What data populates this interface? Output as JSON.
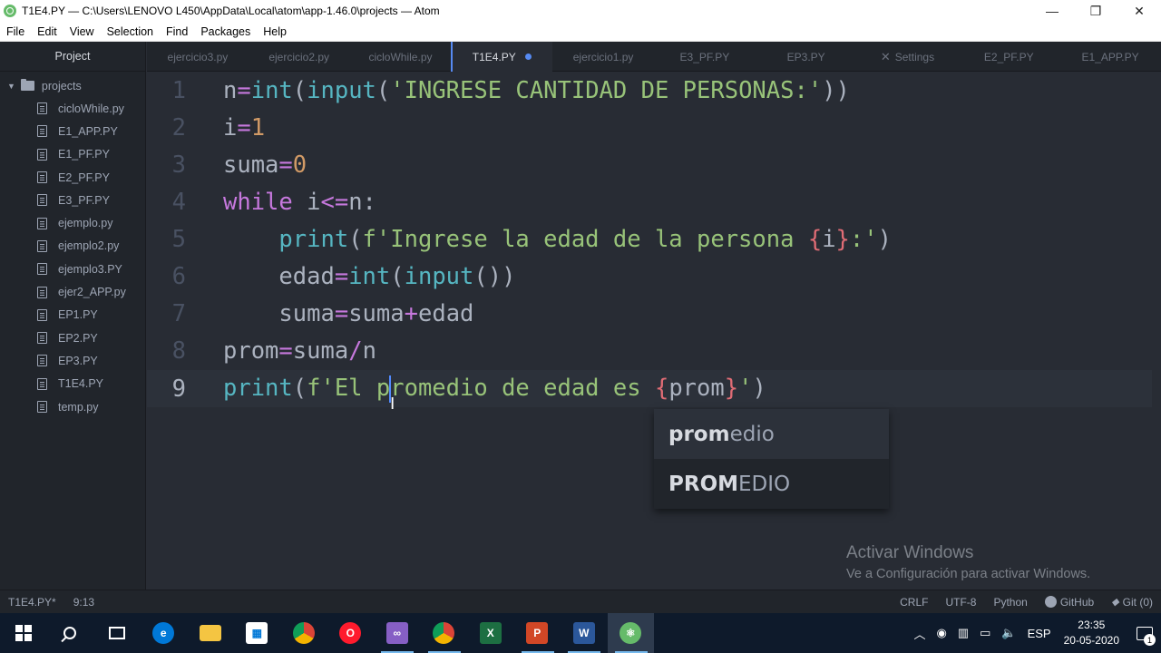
{
  "window": {
    "title": "T1E4.PY — C:\\Users\\LENOVO L450\\AppData\\Local\\atom\\app-1.46.0\\projects — Atom",
    "minimize": "—",
    "maximize": "❐",
    "close": "✕"
  },
  "menu": [
    "File",
    "Edit",
    "View",
    "Selection",
    "Find",
    "Packages",
    "Help"
  ],
  "tree": {
    "header": "Project",
    "root": "projects",
    "files": [
      "cicloWhile.py",
      "E1_APP.PY",
      "E1_PF.PY",
      "E2_PF.PY",
      "E3_PF.PY",
      "ejemplo.py",
      "ejemplo2.py",
      "ejemplo3.PY",
      "ejer2_APP.py",
      "EP1.PY",
      "EP2.PY",
      "EP3.PY",
      "T1E4.PY",
      "temp.py"
    ]
  },
  "tabs": [
    "ejercicio3.py",
    "ejercicio2.py",
    "cicloWhile.py",
    "T1E4.PY",
    "ejercicio1.py",
    "E3_PF.PY",
    "EP3.PY",
    "Settings",
    "E2_PF.PY",
    "E1_APP.PY"
  ],
  "active_tab_index": 3,
  "code": {
    "line_numbers": [
      "1",
      "2",
      "3",
      "4",
      "5",
      "6",
      "7",
      "8",
      "9"
    ],
    "l1": {
      "a": "n",
      "b": "=",
      "c": "int",
      "d": "(",
      "e": "input",
      "f": "(",
      "g": "'INGRESE CANTIDAD DE PERSONAS:'",
      "h": "))"
    },
    "l2": {
      "a": "i",
      "b": "=",
      "c": "1"
    },
    "l3": {
      "a": "suma",
      "b": "=",
      "c": "0"
    },
    "l4": {
      "a": "while",
      "b": " i",
      "c": "<=",
      "d": "n:"
    },
    "l5": {
      "indent": "    ",
      "a": "print",
      "b": "(",
      "c": "f'Ingrese la edad de la persona ",
      "d": "{",
      "e": "i",
      "f": "}",
      "g": ":'",
      "h": ")"
    },
    "l6": {
      "indent": "    ",
      "a": "edad",
      "b": "=",
      "c": "int",
      "d": "(",
      "e": "input",
      "f": "())"
    },
    "l7": {
      "indent": "    ",
      "a": "suma",
      "b": "=",
      "c": "suma",
      "d": "+",
      "e": "edad"
    },
    "l8": {
      "a": "prom",
      "b": "=",
      "c": "suma",
      "d": "/",
      "e": "n"
    },
    "l9": {
      "a": "print",
      "b": "(",
      "c": "f'El p",
      "c2": "romedio de edad es ",
      "d": "{",
      "e": "prom",
      "f": "}",
      "g": "'",
      "h": ")"
    }
  },
  "autocomplete": [
    {
      "match": "prom",
      "rest": "edio"
    },
    {
      "match": "PROM",
      "rest": "EDIO"
    }
  ],
  "watermark": {
    "title": "Activar Windows",
    "subtitle": "Ve a Configuración para activar Windows."
  },
  "status": {
    "file": "T1E4.PY*",
    "position": "9:13",
    "line_ending": "CRLF",
    "encoding": "UTF-8",
    "grammar": "Python",
    "github": "GitHub",
    "git": "Git (0)"
  },
  "taskbar": {
    "apps": [
      "Edge",
      "Explorer",
      "Store",
      "Chrome",
      "Opera",
      "Visual Studio",
      "Chrome",
      "Excel",
      "PowerPoint",
      "Word",
      "Atom"
    ],
    "language": "ESP",
    "time": "23:35",
    "date": "20-05-2020",
    "notifications": "1"
  },
  "colors": {
    "editor_bg": "#282c34",
    "accent": "#568af2",
    "keyword": "#c678dd",
    "function": "#56b6c2",
    "string": "#98c379",
    "number": "#d19a66"
  }
}
